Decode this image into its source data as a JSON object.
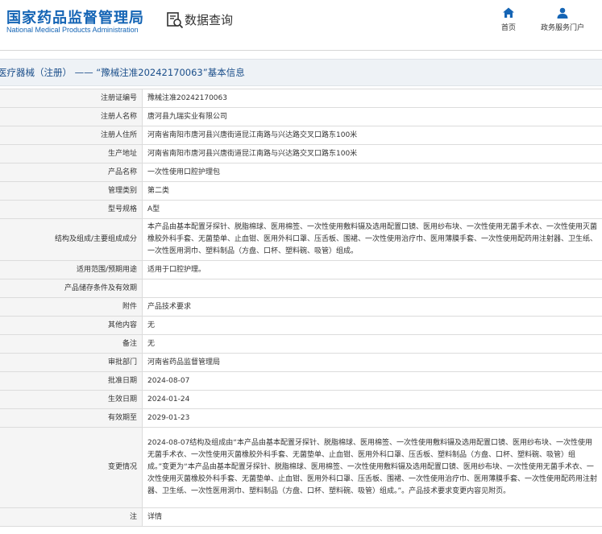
{
  "header": {
    "logo_cn": "国家药品监督管理局",
    "logo_en": "National Medical Products Administration",
    "query_title": "数据查询",
    "nav": [
      {
        "label": "首页",
        "icon": "home-icon"
      },
      {
        "label": "政务服务门户",
        "icon": "user-icon"
      }
    ]
  },
  "title_bar": "医疗器械（注册） —— “豫械注准20242170063”基本信息",
  "colors": {
    "brand": "#1565b5",
    "link": "#1a6fc4",
    "label_bg": "#f5f5f5"
  },
  "rows": [
    {
      "label": "注册证编号",
      "value": "豫械注准20242170063"
    },
    {
      "label": "注册人名称",
      "value": "唐河县九瑞实业有限公司"
    },
    {
      "label": "注册人住所",
      "value": "河南省南阳市唐河县兴唐街道昆江南路与兴达路交叉口路东100米"
    },
    {
      "label": "生产地址",
      "value": "河南省南阳市唐河县兴唐街道昆江南路与兴达路交叉口路东100米"
    },
    {
      "label": "产品名称",
      "value": "一次性使用口腔护理包"
    },
    {
      "label": "管理类别",
      "value": "第二类"
    },
    {
      "label": "型号规格",
      "value": "A型"
    },
    {
      "label": "结构及组成/主要组成成分",
      "value": "本产品由基本配置牙探针、脱脂棉球、医用棉签、一次性使用敷料镊及选用配置口镜、医用纱布块、一次性使用无菌手术衣、一次性使用灭菌橡胶外科手套、无菌垫单、止血钳、医用外科口罩、压舌板、围裙、一次性使用治疗巾、医用薄膜手套、一次性使用配药用注射器、卫生纸、一次性医用洞巾、塑料制品（方盘、口杯、塑料碗、吸管）组成。"
    },
    {
      "label": "适用范围/预期用途",
      "value": "适用于口腔护理。"
    },
    {
      "label": "产品储存条件及有效期",
      "value": ""
    },
    {
      "label": "附件",
      "value": "产品技术要求"
    },
    {
      "label": "其他内容",
      "value": "无"
    },
    {
      "label": "备注",
      "value": "无"
    },
    {
      "label": "审批部门",
      "value": "河南省药品监督管理局"
    },
    {
      "label": "批准日期",
      "value": "2024-08-07"
    },
    {
      "label": "生效日期",
      "value": "2024-01-24"
    },
    {
      "label": "有效期至",
      "value": "2029-01-23"
    },
    {
      "label": "变更情况",
      "value": "2024-08-07结构及组成由“本产品由基本配置牙探针、脱脂棉球、医用棉签、一次性使用敷料镊及选用配置口镜、医用纱布块、一次性使用无菌手术衣、一次性使用灭菌橡胶外科手套、无菌垫单、止血钳、医用外科口罩、压舌板、塑料制品（方盘、口杯、塑料碗、吸管）组成。”变更为“本产品由基本配置牙探针、脱脂棉球、医用棉签、一次性使用敷料镊及选用配置口镜、医用纱布块、一次性使用无菌手术衣、一次性使用灭菌橡胶外科手套、无菌垫单、止血钳、医用外科口罩、压舌板、围裙、一次性使用治疗巾、医用薄膜手套、一次性使用配药用注射器、卫生纸、一次性医用洞巾、塑料制品（方盘、口杯、塑料碗、吸管）组成。”。产品技术要求变更内容见附页。"
    },
    {
      "label": "注",
      "value": "详情",
      "link": true
    }
  ]
}
